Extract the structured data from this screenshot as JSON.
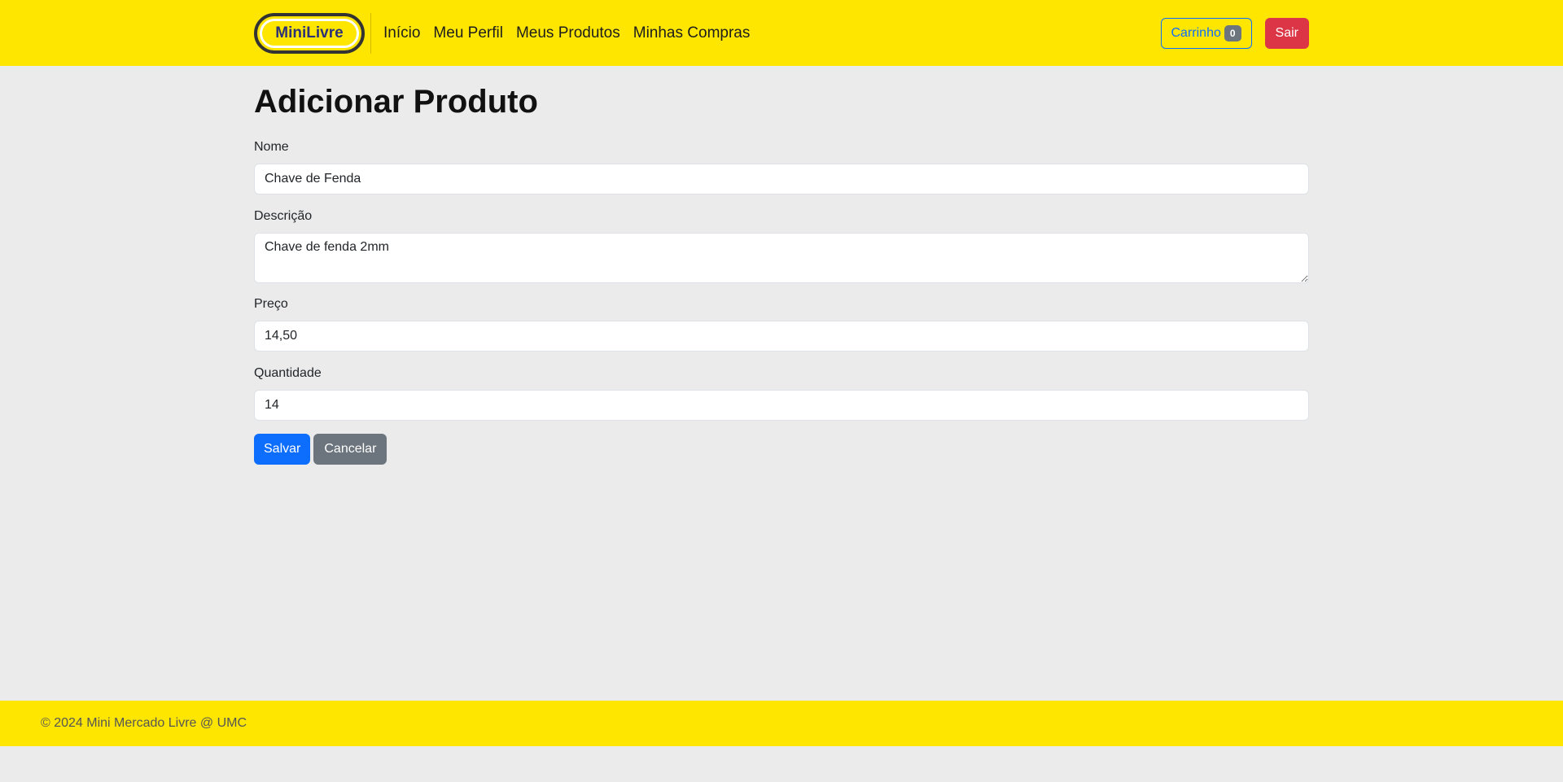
{
  "header": {
    "brand": "MiniLivre",
    "nav": [
      {
        "label": "Início"
      },
      {
        "label": "Meu Perfil"
      },
      {
        "label": "Meus Produtos"
      },
      {
        "label": "Minhas Compras"
      }
    ],
    "cart_label": "Carrinho",
    "cart_count": "0",
    "logout_label": "Sair"
  },
  "form": {
    "title": "Adicionar Produto",
    "name_label": "Nome",
    "name_value": "Chave de Fenda",
    "description_label": "Descrição",
    "description_value": "Chave de fenda 2mm",
    "price_label": "Preço",
    "price_value": "14,50",
    "quantity_label": "Quantidade",
    "quantity_value": "14",
    "save_label": "Salvar",
    "cancel_label": "Cancelar"
  },
  "footer": {
    "text": "© 2024 Mini Mercado Livre @ UMC"
  },
  "colors": {
    "brand_yellow": "#ffe600",
    "primary": "#0d6efd",
    "danger": "#dc3545",
    "secondary": "#6c757d"
  }
}
